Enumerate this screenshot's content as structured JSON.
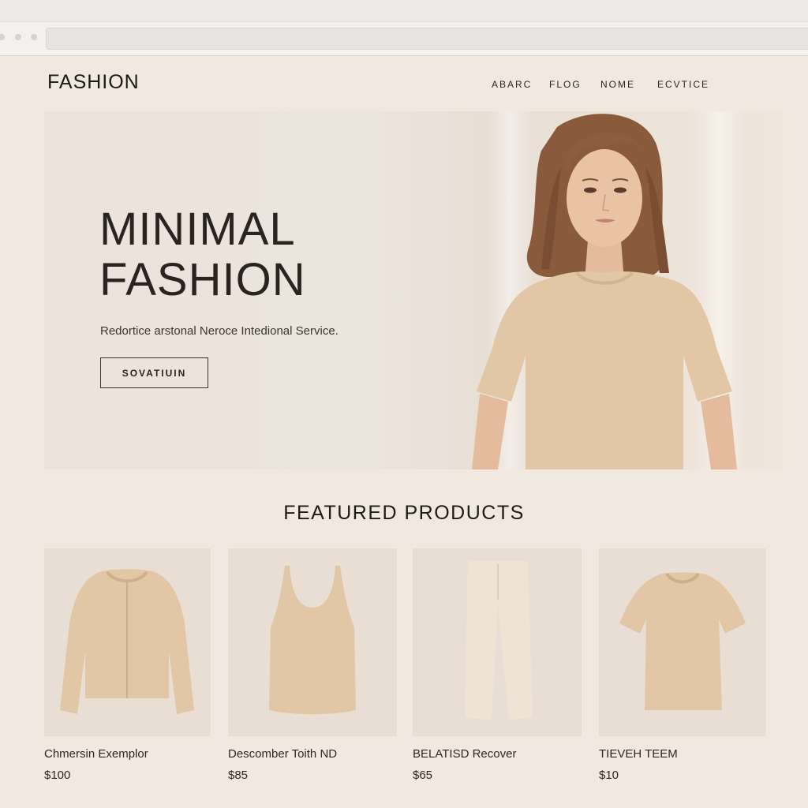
{
  "site": {
    "brand": "FASHION",
    "nav": [
      "ABARC",
      "FLOG",
      "NOME",
      "ECVTICE"
    ]
  },
  "hero": {
    "title_line1": "MINIMAL",
    "title_line2": "FASHION",
    "subtitle": "Redortice arstonal Neroce Intedional Service.",
    "button_label": "SOVATIUIN"
  },
  "featured": {
    "title": "FEATURED PRODUCTS",
    "products": [
      {
        "name": "Chmersin Exemplor",
        "price": "$100",
        "icon": "cardigan-image"
      },
      {
        "name": "Descomber Toith ND",
        "price": "$85",
        "icon": "tank-top-image"
      },
      {
        "name": "BELATISD Recover",
        "price": "$65",
        "icon": "trousers-image"
      },
      {
        "name": "TIEVEH TEEM",
        "price": "$10",
        "icon": "t-shirt-image"
      }
    ]
  },
  "colors": {
    "page_bg": "#f1e8df",
    "garment": "#e2c7a6",
    "text": "#1f1a17"
  }
}
